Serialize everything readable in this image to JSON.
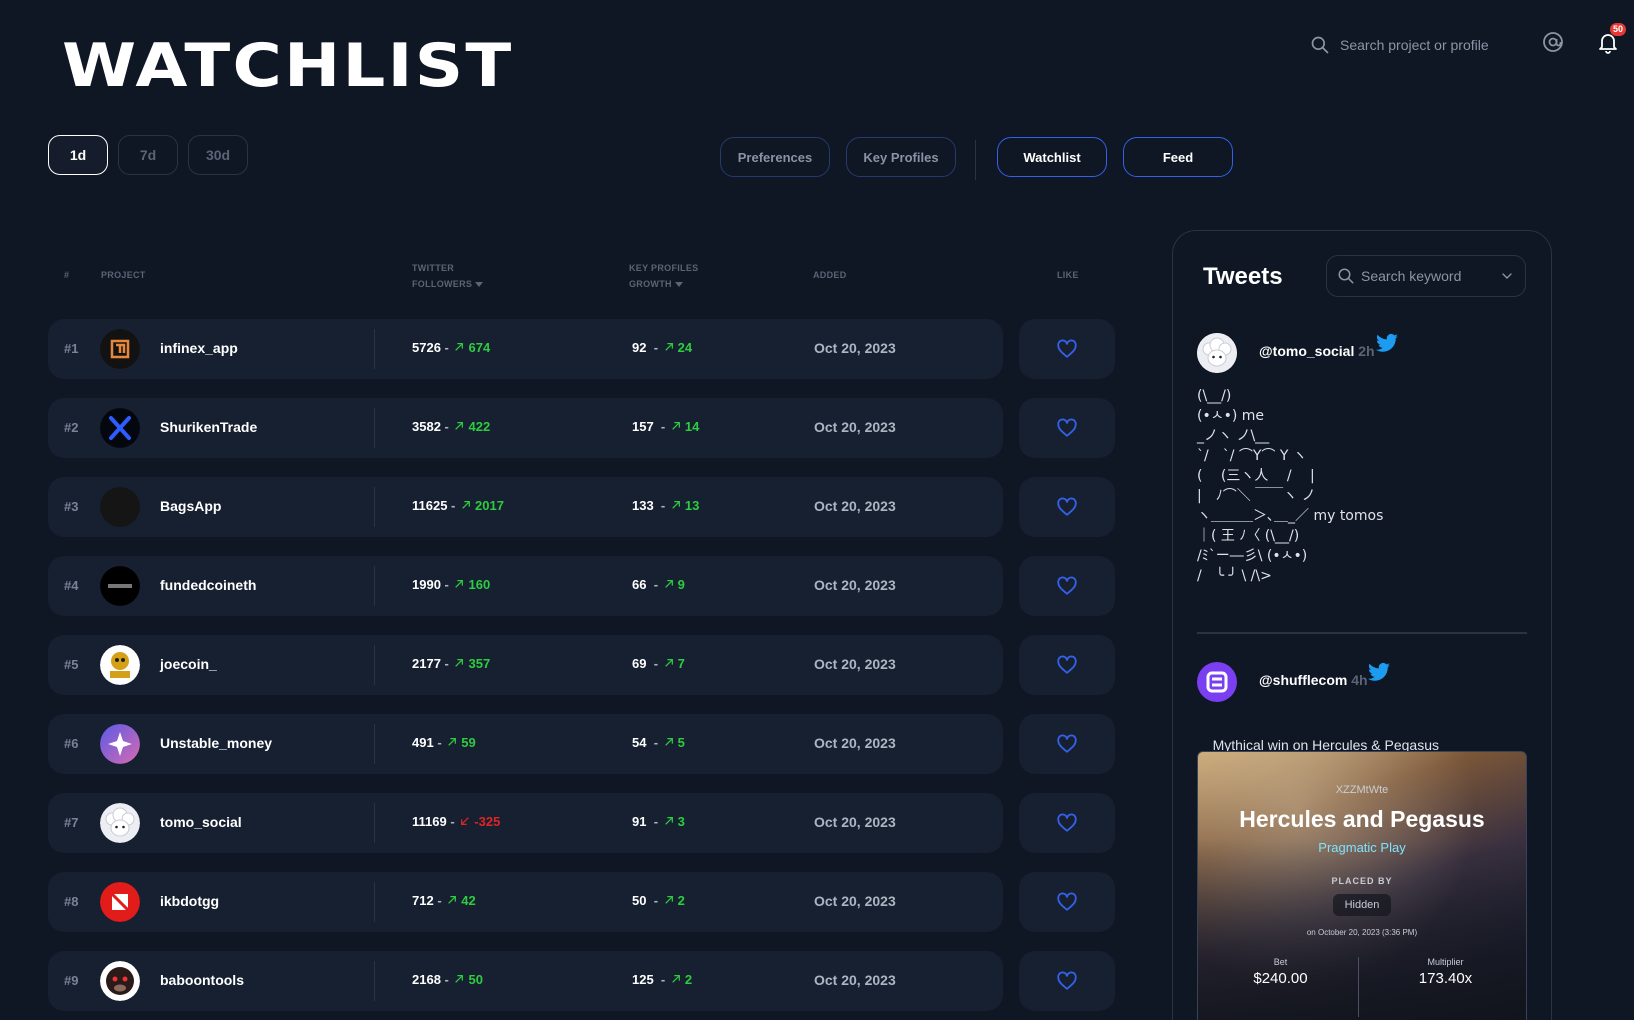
{
  "header": {
    "title": "WATCHLIST",
    "search_placeholder": "Search project or profile",
    "notification_count": "50"
  },
  "ranges": [
    "1d",
    "7d",
    "30d"
  ],
  "nav": {
    "preferences": "Preferences",
    "key_profiles": "Key Profiles",
    "watchlist": "Watchlist",
    "feed": "Feed"
  },
  "table": {
    "columns": {
      "rank": "#",
      "project": "PROJECT",
      "twitter_line1": "TWITTER",
      "twitter_line2": "FOLLOWERS",
      "key_line1": "KEY PROFILES",
      "key_line2": "GROWTH",
      "added": "ADDED",
      "like": "LIKE"
    },
    "rows": [
      {
        "rank": "#1",
        "name": "infinex_app",
        "followers": "5726",
        "followers_delta": "674",
        "followers_dir": "up",
        "key": "92",
        "key_delta": "24",
        "added": "Oct 20, 2023"
      },
      {
        "rank": "#2",
        "name": "ShurikenTrade",
        "followers": "3582",
        "followers_delta": "422",
        "followers_dir": "up",
        "key": "157",
        "key_delta": "14",
        "added": "Oct 20, 2023"
      },
      {
        "rank": "#3",
        "name": "BagsApp",
        "followers": "11625",
        "followers_delta": "2017",
        "followers_dir": "up",
        "key": "133",
        "key_delta": "13",
        "added": "Oct 20, 2023"
      },
      {
        "rank": "#4",
        "name": "fundedcoineth",
        "followers": "1990",
        "followers_delta": "160",
        "followers_dir": "up",
        "key": "66",
        "key_delta": "9",
        "added": "Oct 20, 2023"
      },
      {
        "rank": "#5",
        "name": "joecoin_",
        "followers": "2177",
        "followers_delta": "357",
        "followers_dir": "up",
        "key": "69",
        "key_delta": "7",
        "added": "Oct 20, 2023"
      },
      {
        "rank": "#6",
        "name": "Unstable_money",
        "followers": "491",
        "followers_delta": "59",
        "followers_dir": "up",
        "key": "54",
        "key_delta": "5",
        "added": "Oct 20, 2023"
      },
      {
        "rank": "#7",
        "name": "tomo_social",
        "followers": "11169",
        "followers_delta": "-325",
        "followers_dir": "down",
        "key": "91",
        "key_delta": "3",
        "added": "Oct 20, 2023"
      },
      {
        "rank": "#8",
        "name": "ikbdotgg",
        "followers": "712",
        "followers_delta": "42",
        "followers_dir": "up",
        "key": "50",
        "key_delta": "2",
        "added": "Oct 20, 2023"
      },
      {
        "rank": "#9",
        "name": "baboontools",
        "followers": "2168",
        "followers_delta": "50",
        "followers_dir": "up",
        "key": "125",
        "key_delta": "2",
        "added": "Oct 20, 2023"
      }
    ]
  },
  "tweets": {
    "title": "Tweets",
    "search_placeholder": "Search keyword",
    "items": [
      {
        "handle": "@tomo_social",
        "time": "2h",
        "text": "(\\__/)\n(•ㅅ•) me\n_ノヽ ノ\\__\n`/　`/ ⌒Y⌒ Y ヽ\n( 　(三ヽ人　 /　 |\n|　ﾉ⌒＼ ￣￣ヽ ノ\nヽ＿＿＿＞､＿_／ my tomos\n｜( 王 ﾉ〈 (\\__/)\n/ﾐ`ー―彡\\ (•ㅅ•)\n/　╰ ╯ \\ /\\>"
      },
      {
        "handle": "@shufflecom",
        "time": "4h",
        "text": "Mythical win on Hercules & Pegasus",
        "card": {
          "user": "XZZMtWte",
          "game": "Hercules and Pegasus",
          "provider": "Pragmatic Play",
          "placed_by_label": "PLACED BY",
          "placed_by": "Hidden",
          "date": "on October 20, 2023 (3:36 PM)",
          "bet_label": "Bet",
          "bet": "$240.00",
          "multiplier_label": "Multiplier",
          "multiplier": "173.40x"
        }
      }
    ]
  },
  "colors": {
    "background": "#0f1624",
    "row": "#162030",
    "accent": "#3560e8",
    "up": "#2ecc40",
    "down": "#e02424",
    "twitter": "#1d9bf0"
  }
}
